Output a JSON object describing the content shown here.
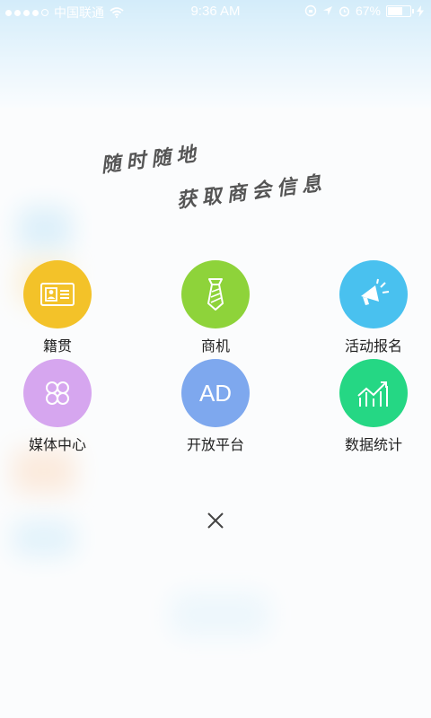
{
  "status_bar": {
    "carrier": "中国联通",
    "time": "9:36 AM",
    "battery": "67%",
    "battery_level": 0.67
  },
  "slogan": {
    "line1": "随时随地",
    "line2": "获取商会信息"
  },
  "menu": {
    "items": [
      {
        "label": "籍贯",
        "icon": "id-card-icon",
        "color": "#F3C229"
      },
      {
        "label": "商机",
        "icon": "tie-icon",
        "color": "#8ED33A"
      },
      {
        "label": "活动报名",
        "icon": "megaphone-icon",
        "color": "#49C1EF"
      },
      {
        "label": "媒体中心",
        "icon": "clover-icon",
        "color": "#D6A6EF"
      },
      {
        "label": "开放平台",
        "icon": "ad-icon",
        "icon_text": "AD",
        "color": "#7EA8EE"
      },
      {
        "label": "数据统计",
        "icon": "chart-icon",
        "color": "#25D784"
      }
    ]
  }
}
